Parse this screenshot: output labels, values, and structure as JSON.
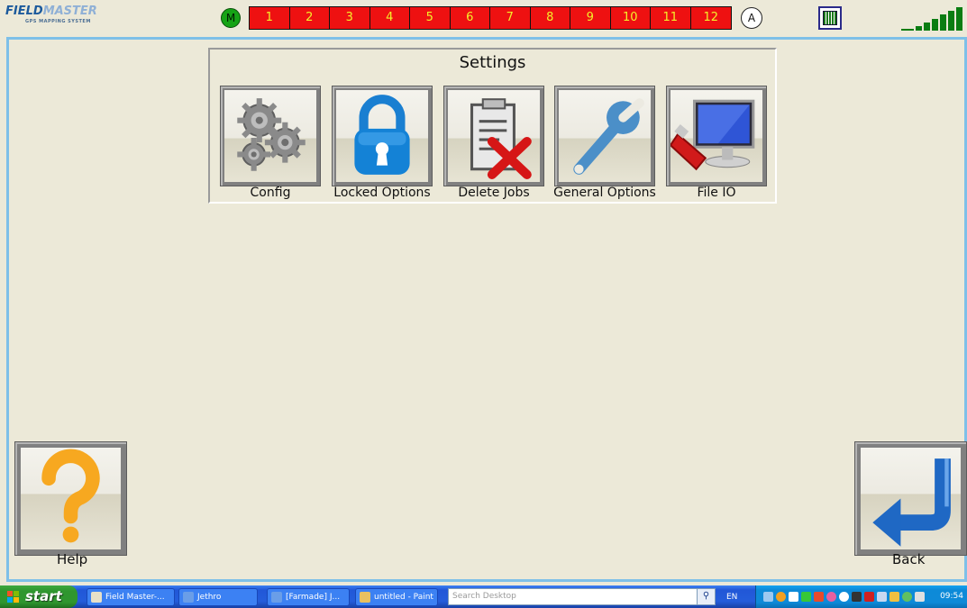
{
  "header": {
    "logo_text_a": "FIELD",
    "logo_text_b": "MASTER",
    "logo_subtitle": "GPS MAPPING SYSTEM",
    "master_indicator": "M",
    "sections": [
      "1",
      "2",
      "3",
      "4",
      "5",
      "6",
      "7",
      "8",
      "9",
      "10",
      "11",
      "12"
    ],
    "auto_indicator": "A",
    "section_color": "#ee1111",
    "master_color": "#16a316"
  },
  "settings": {
    "title": "Settings",
    "items": [
      {
        "label": "Config",
        "icon": "gears-icon"
      },
      {
        "label": "Locked Options",
        "icon": "padlock-icon"
      },
      {
        "label": "Delete Jobs",
        "icon": "clipboard-delete-icon"
      },
      {
        "label": "General Options",
        "icon": "wrench-icon"
      },
      {
        "label": "File IO",
        "icon": "usb-computer-icon"
      }
    ]
  },
  "help": {
    "label": "Help",
    "icon": "question-mark-icon"
  },
  "back": {
    "label": "Back",
    "icon": "return-arrow-icon"
  },
  "frame_color": "#7ec0e8",
  "taskbar": {
    "start_label": "start",
    "tasks": [
      "Field Master-...",
      "Jethro",
      "[Farmade] J...",
      "untitled - Paint"
    ],
    "search_placeholder": "Search Desktop",
    "language": "EN",
    "clock": "09:54"
  }
}
